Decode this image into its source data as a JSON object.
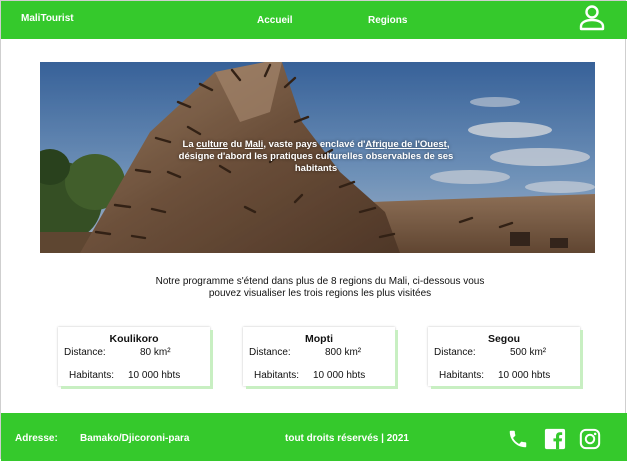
{
  "header": {
    "brand": "MaliTourist",
    "nav": {
      "home": "Accueil",
      "regions": "Regions"
    },
    "user_icon": "user-icon"
  },
  "hero": {
    "caption_p1": "La ",
    "caption_link1": "culture",
    "caption_p2": " du ",
    "caption_link2": "Mali",
    "caption_p3": ", vaste pays enclavé d'",
    "caption_link3": "Afrique de l'Ouest",
    "caption_p4": ", désigne d'abord les pratiques culturelles observables de ses habitants"
  },
  "intro": {
    "line1": "Notre programme s'étend dans plus de 8 regions  du Mali, ci-dessous vous",
    "line2": "pouvez visualiser les trois regions les plus visitées"
  },
  "cards": [
    {
      "title": "Koulikoro",
      "distance_label": "Distance:",
      "distance_value": "80 km²",
      "habitants_label": "Habitants:",
      "habitants_value": "10 000 hbts"
    },
    {
      "title": "Mopti",
      "distance_label": "Distance:",
      "distance_value": "800 km²",
      "habitants_label": "Habitants:",
      "habitants_value": "10 000 hbts"
    },
    {
      "title": "Segou",
      "distance_label": "Distance:",
      "distance_value": "500 km²",
      "habitants_label": "Habitants:",
      "habitants_value": "10 000 hbts"
    }
  ],
  "footer": {
    "address_label": "Adresse:",
    "address_value": "Bamako/Djicoroni-para",
    "rights": "tout droits réservés | 2021",
    "icons": [
      "phone-icon",
      "facebook-icon",
      "instagram-icon"
    ]
  },
  "colors": {
    "brand_green": "#35c92c",
    "card_shadow": "#c8efc2"
  }
}
